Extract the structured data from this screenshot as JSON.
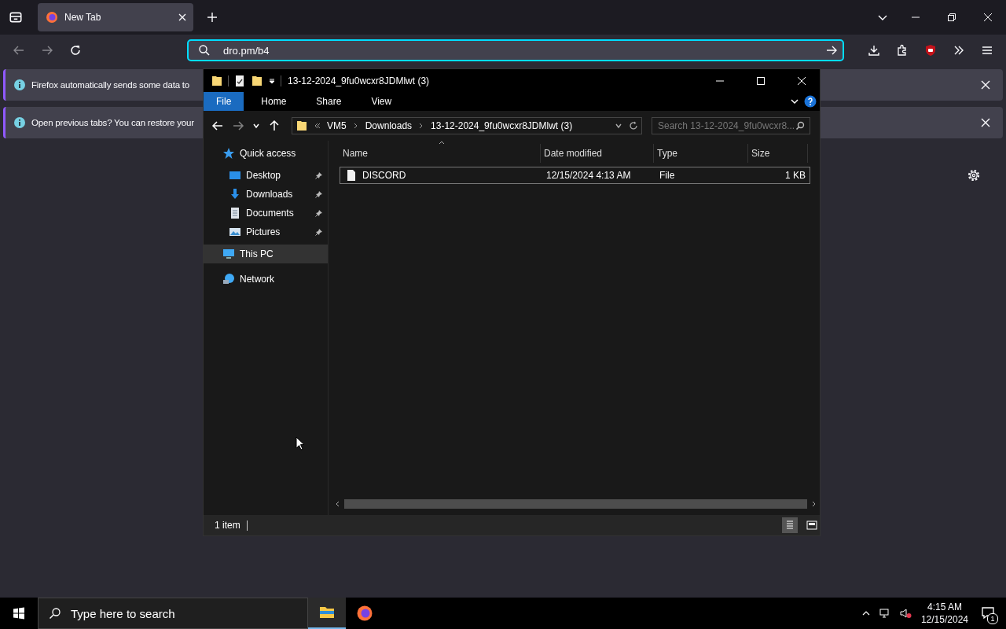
{
  "browser": {
    "tabs": [
      {
        "title": "New Tab",
        "selected": true
      }
    ],
    "url": "dro.pm/b4",
    "notifications": [
      {
        "text": "Firefox automatically sends some data to"
      },
      {
        "text": "Open previous tabs? You can restore your"
      }
    ]
  },
  "explorer": {
    "title": "13-12-2024_9fu0wcxr8JDMlwt (3)",
    "ribbon_tabs": [
      {
        "label": "File",
        "selected": true
      },
      {
        "label": "Home",
        "selected": false
      },
      {
        "label": "Share",
        "selected": false
      },
      {
        "label": "View",
        "selected": false
      }
    ],
    "breadcrumb": [
      "VM5",
      "Downloads",
      "13-12-2024_9fu0wcxr8JDMlwt (3)"
    ],
    "search": {
      "placeholder": "Search 13-12-2024_9fu0wcxr8..."
    },
    "nav": [
      {
        "label": "Quick access",
        "kind": "star",
        "selected": false,
        "children": [
          {
            "label": "Desktop",
            "kind": "desktop",
            "pinned": true,
            "selected": false
          },
          {
            "label": "Downloads",
            "kind": "download",
            "pinned": true,
            "selected": false
          },
          {
            "label": "Documents",
            "kind": "document",
            "pinned": true,
            "selected": false
          },
          {
            "label": "Pictures",
            "kind": "pictures",
            "pinned": true,
            "selected": false
          }
        ]
      },
      {
        "label": "This PC",
        "kind": "pc",
        "selected": true
      },
      {
        "label": "Network",
        "kind": "network",
        "selected": false
      }
    ],
    "columns": [
      "Name",
      "Date modified",
      "Type",
      "Size"
    ],
    "rows": [
      {
        "cells": [
          "DISCORD",
          "12/15/2024 4:13 AM",
          "File",
          "1 KB"
        ],
        "focused": true
      }
    ],
    "status": "1 item"
  },
  "taskbar": {
    "search": {
      "placeholder": "Type here to search"
    },
    "apps": [
      {
        "kind": "explorer",
        "active": true
      },
      {
        "kind": "firefox",
        "active": false
      }
    ],
    "time": "4:15 AM",
    "date": "12/15/2024",
    "notification_count": "1"
  }
}
